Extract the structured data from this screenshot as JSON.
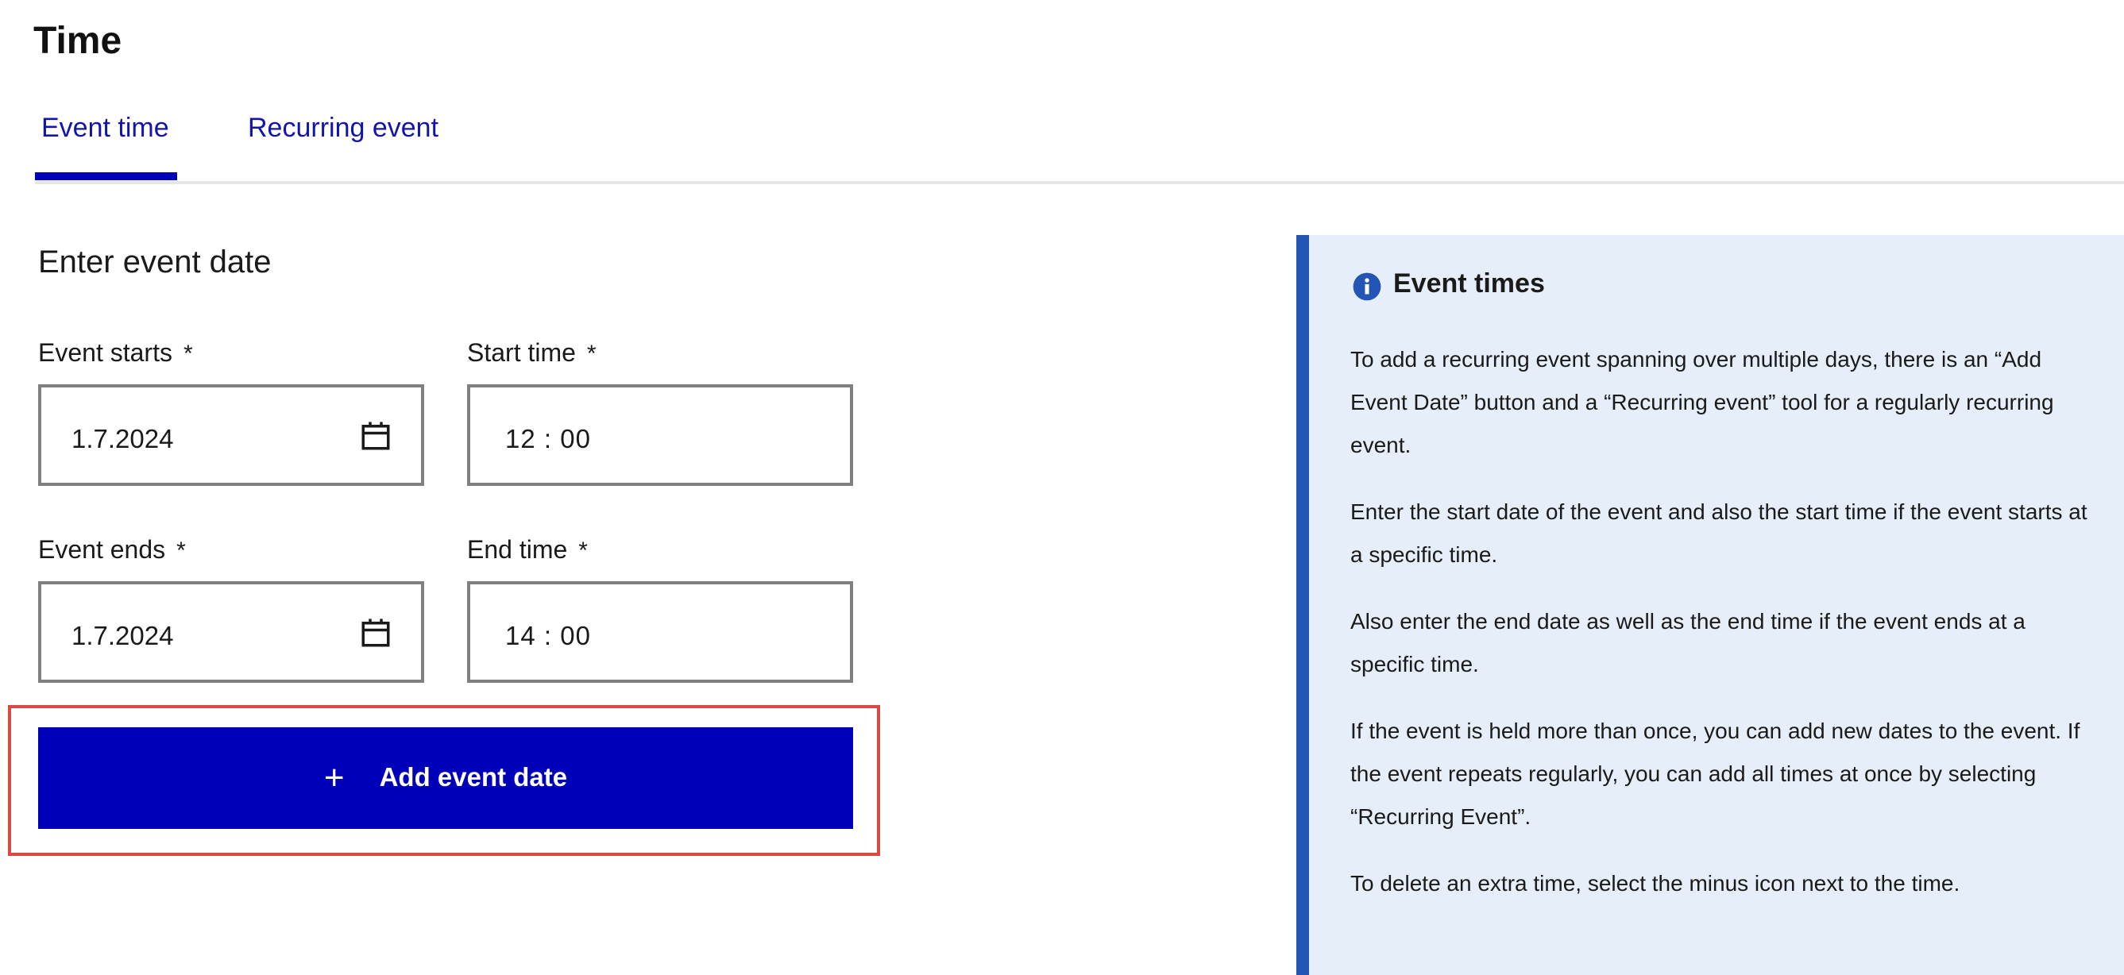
{
  "page": {
    "title": "Time"
  },
  "tabs": [
    {
      "label": "Event time",
      "active": true
    },
    {
      "label": "Recurring event",
      "active": false
    }
  ],
  "form": {
    "section_title": "Enter event date",
    "event_starts": {
      "label": "Event starts",
      "required_mark": "*",
      "value": "1.7.2024",
      "icon": "calendar-icon"
    },
    "start_time": {
      "label": "Start time",
      "required_mark": "*",
      "value": "12 : 00"
    },
    "event_ends": {
      "label": "Event ends",
      "required_mark": "*",
      "value": "1.7.2024",
      "icon": "calendar-icon"
    },
    "end_time": {
      "label": "End time",
      "required_mark": "*",
      "value": "14 : 00"
    },
    "add_button": {
      "icon": "+",
      "label": "Add event date"
    }
  },
  "info": {
    "icon": "info-icon",
    "title": "Event times",
    "paragraphs": [
      "To add a recurring event spanning over multiple days, there is an “Add Event Date” button and a “Recurring event” tool for a regularly recurring event.",
      "Enter the start date of the event and also the start time if the event starts at a specific time.",
      "Also enter the end date as well as the end time if the event ends at a specific time.",
      "If the event is held more than once, you can add new dates to the event. If the event repeats regularly, you can add all times at once by selecting “Recurring Event”.",
      "To delete an extra time, select the minus icon next to the time."
    ]
  },
  "colors": {
    "primary": "#0000b8",
    "tab_text": "#1414a8",
    "highlight_border": "#d94a44",
    "info_bg": "#e6eef9",
    "info_border": "#2355b5"
  }
}
